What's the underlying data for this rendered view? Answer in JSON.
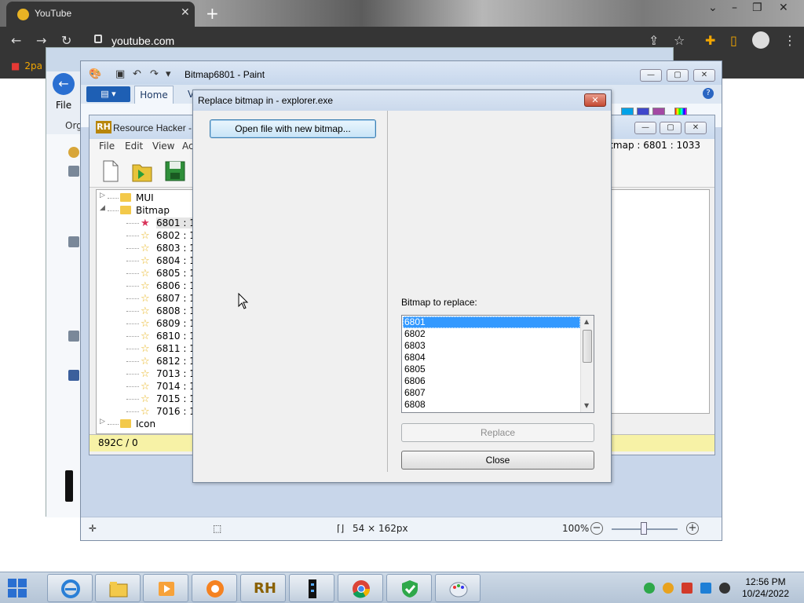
{
  "browser": {
    "tab_title": "YouTube",
    "tab_close": "✕",
    "new_tab": "+",
    "url": "youtube.com",
    "bookmark": "2pa",
    "win_minimize": "⌄",
    "win_min": "–",
    "win_max": "❐",
    "win_close": "✕"
  },
  "explorer": {
    "file_label": "File",
    "org_label": "Org"
  },
  "paint": {
    "title": "Bitmap6801 - Paint",
    "home_tab": "Home",
    "view_tab": "V",
    "help": "?",
    "status_size": "54 × 162px",
    "zoom": "100%",
    "zoom_minus": "−",
    "zoom_plus": "+",
    "minimize": "—",
    "maximize": "▢",
    "close": "✕",
    "swatches": [
      "#00a2e8",
      "#3f48cc",
      "#a349a4",
      "#ffffff"
    ]
  },
  "rh": {
    "title": "Resource Hacker - e",
    "menu": [
      "File",
      "Edit",
      "View",
      "Ac"
    ],
    "bitmap_label": "Bitmap : 6801 : 1033",
    "tree": [
      {
        "label": "MUI",
        "type": "folder",
        "expander": "▷"
      },
      {
        "label": "Bitmap",
        "type": "folder-open",
        "expander": "◢"
      },
      {
        "label": "6801 : 1",
        "type": "item",
        "selected": true
      },
      {
        "label": "6802 : 1",
        "type": "item"
      },
      {
        "label": "6803 : 1",
        "type": "item"
      },
      {
        "label": "6804 : 1",
        "type": "item"
      },
      {
        "label": "6805 : 1",
        "type": "item"
      },
      {
        "label": "6806 : 1",
        "type": "item"
      },
      {
        "label": "6807 : 1",
        "type": "item"
      },
      {
        "label": "6808 : 1",
        "type": "item"
      },
      {
        "label": "6809 : 1",
        "type": "item"
      },
      {
        "label": "6810 : 1",
        "type": "item"
      },
      {
        "label": "6811 : 1",
        "type": "item"
      },
      {
        "label": "6812 : 1",
        "type": "item"
      },
      {
        "label": "7013 : 1",
        "type": "item"
      },
      {
        "label": "7014 : 1",
        "type": "item"
      },
      {
        "label": "7015 : 1",
        "type": "item"
      },
      {
        "label": "7016 : 1",
        "type": "item"
      },
      {
        "label": "Icon",
        "type": "folder",
        "expander": "▷"
      }
    ],
    "status": "892C / 0",
    "minimize": "—",
    "maximize": "▢",
    "close": "✕"
  },
  "dialog": {
    "title": "Replace bitmap in - explorer.exe",
    "close": "✕",
    "open_button": "Open file with new bitmap...",
    "list_label": "Bitmap to replace:",
    "list_items": [
      "6801",
      "6802",
      "6803",
      "6804",
      "6805",
      "6806",
      "6807",
      "6808"
    ],
    "selected_index": 0,
    "replace_button": "Replace",
    "close_button": "Close"
  },
  "taskbar": {
    "time": "12:56 PM",
    "date": "10/24/2022",
    "rh_label": "RH"
  },
  "colors": {
    "selection": "#3399ff",
    "rh_status": "#f7f2a6",
    "chrome_dark": "#353535"
  }
}
